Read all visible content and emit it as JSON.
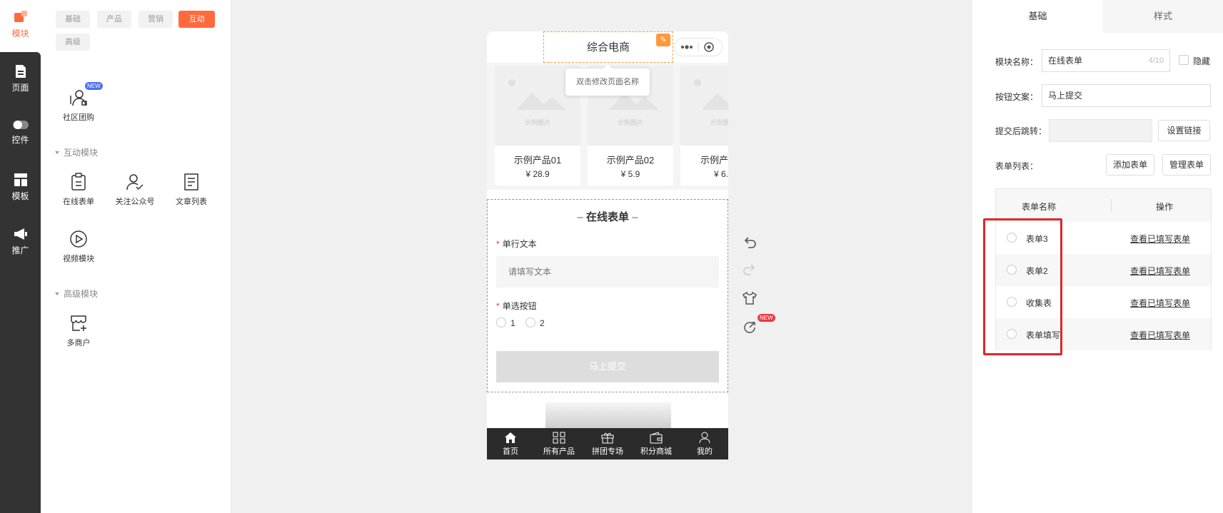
{
  "nav": {
    "items": [
      {
        "label": "模块"
      },
      {
        "label": "页面"
      },
      {
        "label": "控件"
      },
      {
        "label": "模板"
      },
      {
        "label": "推广"
      }
    ],
    "accent": "#ff6a3d"
  },
  "panel": {
    "tabs": [
      "基础",
      "产品",
      "营销",
      "互动",
      "高级"
    ],
    "active_tab": "互动",
    "top_modules": [
      {
        "label": "社区团购",
        "badge": "NEW"
      }
    ],
    "sections": [
      {
        "title": "互动模块",
        "modules": [
          "在线表单",
          "关注公众号",
          "文章列表",
          "视频模块"
        ]
      },
      {
        "title": "高级模块",
        "modules": [
          "多商户"
        ]
      }
    ]
  },
  "phone": {
    "page_title": "综合电商",
    "tooltip": "双击修改页面名称",
    "products": [
      {
        "image_text": "示例图片",
        "name": "示例产品01",
        "price": "¥ 28.9"
      },
      {
        "image_text": "示例图片",
        "name": "示例产品02",
        "price": "¥ 5.9"
      },
      {
        "image_text": "示例图片",
        "name": "示例产",
        "price": "¥ 6."
      }
    ],
    "form": {
      "title": "在线表单",
      "title_dash": "–",
      "required_mark": "*",
      "field1_label": "单行文本",
      "field1_placeholder": "请填写文本",
      "field2_label": "单选按钮",
      "options": [
        "1",
        "2"
      ],
      "submit": "马上提交"
    },
    "tabbar": [
      "首页",
      "所有产品",
      "拼团专场",
      "积分商城",
      "我的"
    ],
    "tool_badge": "NEW"
  },
  "right": {
    "tabs": [
      "基础",
      "样式"
    ],
    "module_name_label": "模块名称：",
    "module_name_value": "在线表单",
    "module_name_counter": "4/10",
    "hide_label": "隐藏",
    "button_text_label": "按钮文案：",
    "button_text_value": "马上提交",
    "redirect_label": "提交后跳转：",
    "set_link": "设置链接",
    "form_list_label": "表单列表：",
    "add_form": "添加表单",
    "manage_form": "管理表单",
    "table_headers": [
      "表单名称",
      "操作"
    ],
    "rows": [
      {
        "name": "表单3",
        "action": "查看已填写表单"
      },
      {
        "name": "表单2",
        "action": "查看已填写表单"
      },
      {
        "name": "收集表",
        "action": "查看已填写表单"
      },
      {
        "name": "表单填写",
        "action": "查看已填写表单"
      }
    ]
  }
}
